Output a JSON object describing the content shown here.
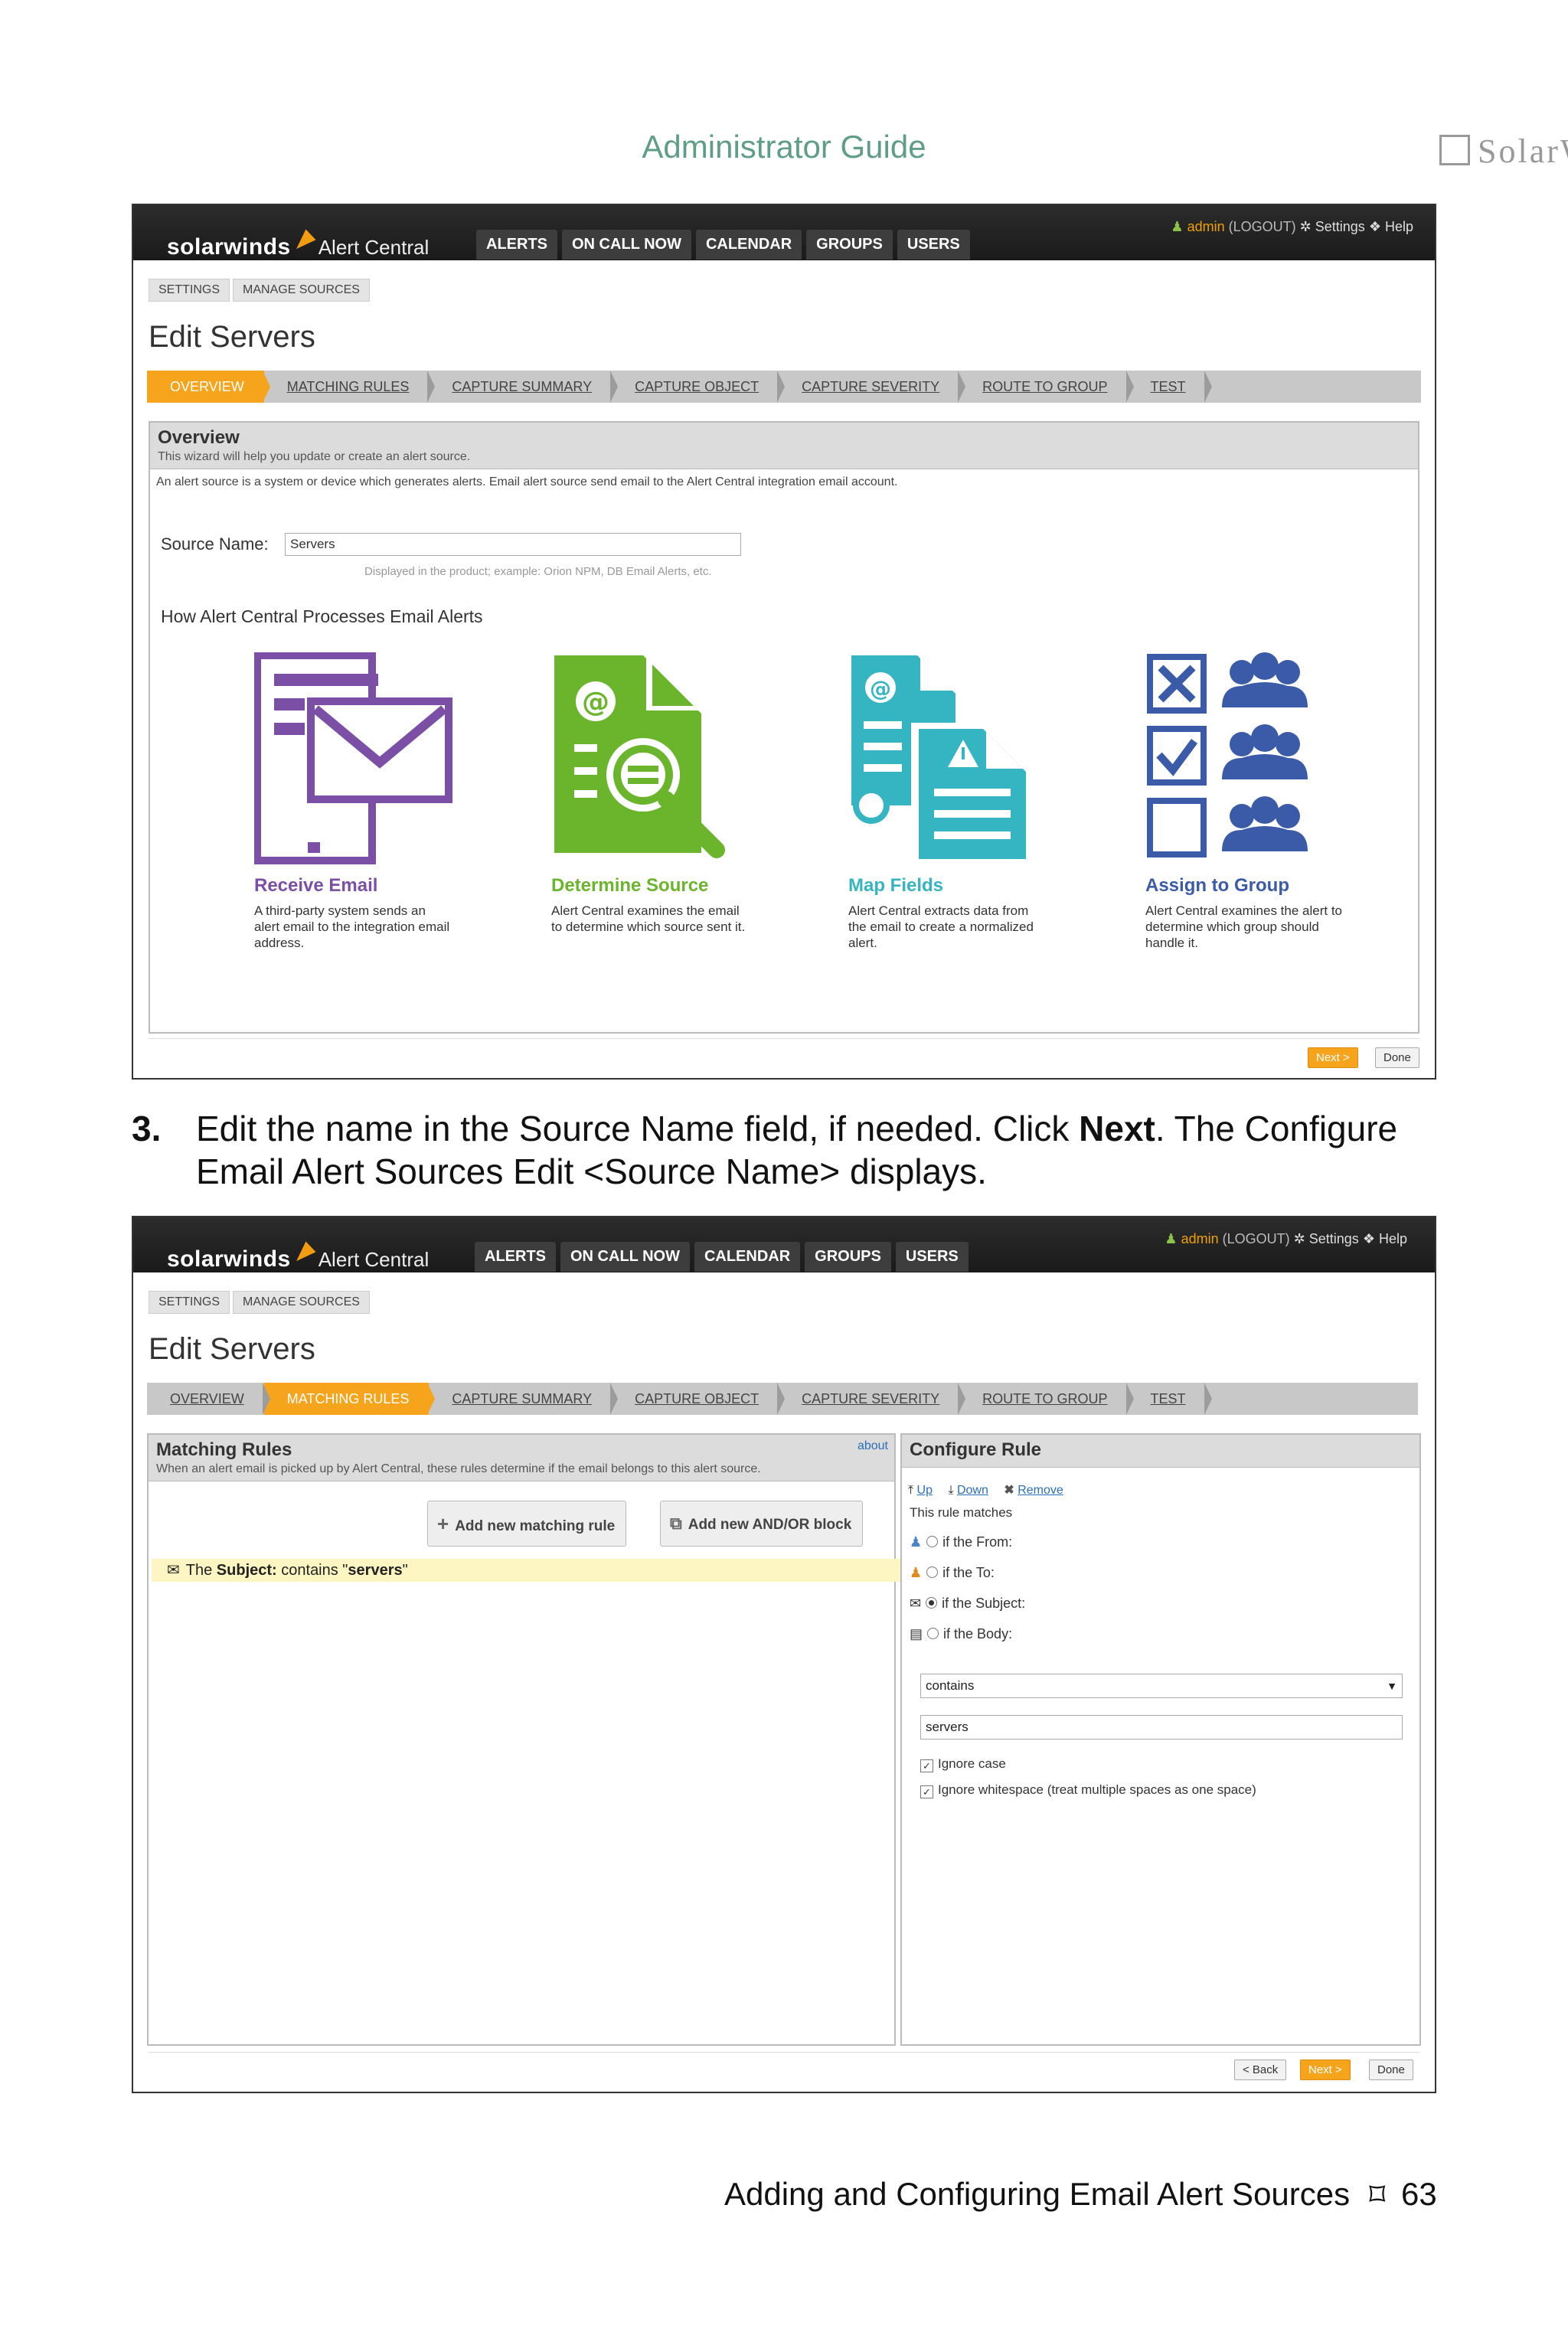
{
  "header": {
    "title": "Administrator Guide",
    "logo_text": "SolarW"
  },
  "app": {
    "brand": "solarwinds",
    "product": "Alert Central",
    "nav": [
      "ALERTS",
      "ON CALL NOW",
      "CALENDAR",
      "GROUPS",
      "USERS"
    ],
    "user": {
      "name": "admin",
      "logout": "(LOGOUT)",
      "settings": "Settings",
      "help": "Help"
    },
    "breadcrumb": [
      "SETTINGS",
      "MANAGE SOURCES"
    ],
    "page_title": "Edit Servers",
    "steps": [
      "OVERVIEW",
      "MATCHING RULES",
      "CAPTURE SUMMARY",
      "CAPTURE OBJECT",
      "CAPTURE SEVERITY",
      "ROUTE TO GROUP",
      "TEST"
    ]
  },
  "screen1": {
    "active_step": 0,
    "overview": {
      "title": "Overview",
      "subtitle": "This wizard will help you update or create an alert source.",
      "intro": "An alert source is a system or device which generates alerts. Email alert source send email to the Alert Central integration email account.",
      "source_label": "Source Name:",
      "source_value": "Servers",
      "hint": "Displayed in the product; example: Orion NPM, DB Email Alerts, etc.",
      "how_title": "How Alert Central Processes Email Alerts"
    },
    "features": [
      {
        "title": "Receive Email",
        "desc": "A third-party system sends an alert email to the integration email address.",
        "color": "#7b4fa6",
        "icon": "email-phone-icon"
      },
      {
        "title": "Determine Source",
        "desc": "Alert Central examines the email to determine which source sent it.",
        "color": "#6ab52b",
        "icon": "document-search-icon"
      },
      {
        "title": "Map Fields",
        "desc": "Alert Central extracts data from the email to create a normalized alert.",
        "color": "#35b4c2",
        "icon": "document-map-icon"
      },
      {
        "title": "Assign to Group",
        "desc": "Alert Central examines the alert to determine which group should handle it.",
        "color": "#3b5aa8",
        "icon": "group-checkbox-icon"
      }
    ],
    "buttons": {
      "next": "Next >",
      "done": "Done"
    }
  },
  "instruction": {
    "number": "3.",
    "text_before": "Edit the name in the Source Name field, if needed. Click ",
    "bold": "Next",
    "text_after": ". The Configure Email Alert Sources Edit <Source Name> displays."
  },
  "screen2": {
    "active_step": 1,
    "matching": {
      "title": "Matching Rules",
      "about": "about",
      "subtitle": "When an alert email is picked up by Alert Central, these rules determine if the email belongs to this alert source.",
      "add_rule": "Add new matching rule",
      "add_block": "Add new AND/OR block",
      "rule_prefix": "The ",
      "rule_bold": "Subject:",
      "rule_middle": " contains \"",
      "rule_value": "servers",
      "rule_suffix": "\""
    },
    "configure": {
      "title": "Configure Rule",
      "tools": [
        "Up",
        "Down",
        "Remove"
      ],
      "matches_label": "This rule matches",
      "options": [
        "if the From:",
        "if the To:",
        "if the Subject:",
        "if the Body:"
      ],
      "selected_option": 2,
      "operator": "contains",
      "value": "servers",
      "checks": [
        "Ignore case",
        "Ignore whitespace (treat multiple spaces as one space)"
      ]
    },
    "buttons": {
      "back": "< Back",
      "next": "Next >",
      "done": "Done"
    }
  },
  "footer": {
    "text": "Adding and Configuring Email Alert Sources",
    "page": "63"
  }
}
